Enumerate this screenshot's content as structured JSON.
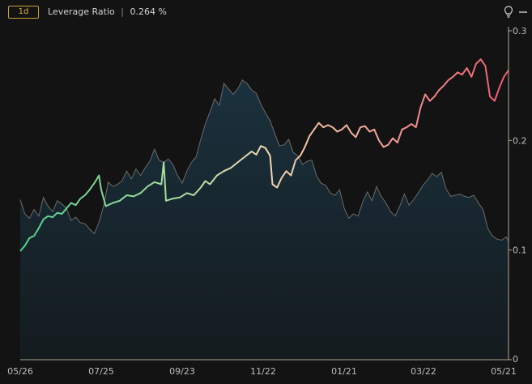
{
  "header": {
    "timeframe": "1d",
    "indicator_name": "Leverage Ratio",
    "separator": "|",
    "current_value": "0.264 %",
    "icons": [
      "lightbulb-icon",
      "minimize-icon"
    ]
  },
  "colors": {
    "background": "#131313",
    "area_fill": "#1a2e3a",
    "price_line": "#6b6b6b",
    "axis": "#b0a894",
    "gradient_low": "#4fd08a",
    "gradient_mid": "#e8dcb0",
    "gradient_high": "#f06070"
  },
  "chart_data": {
    "type": "line",
    "x_ticks": [
      "05/26",
      "07/25",
      "09/23",
      "11/22",
      "01/21",
      "03/22",
      "05/21"
    ],
    "y_ticks": [
      "0",
      "0.1",
      "0.2",
      "0.3"
    ],
    "ylim": [
      0,
      0.3
    ],
    "grid": false,
    "series": [
      {
        "role": "leverage-ratio",
        "style": "gradient-line",
        "points": [
          [
            0,
            0.099
          ],
          [
            2,
            0.104
          ],
          [
            4,
            0.111
          ],
          [
            6,
            0.113
          ],
          [
            8,
            0.12
          ],
          [
            10,
            0.128
          ],
          [
            12,
            0.131
          ],
          [
            14,
            0.13
          ],
          [
            16,
            0.134
          ],
          [
            18,
            0.133
          ],
          [
            20,
            0.138
          ],
          [
            22,
            0.143
          ],
          [
            24,
            0.141
          ],
          [
            26,
            0.147
          ],
          [
            28,
            0.15
          ],
          [
            30,
            0.155
          ],
          [
            32,
            0.161
          ],
          [
            34,
            0.168
          ],
          [
            35,
            0.155
          ],
          [
            37,
            0.14
          ],
          [
            40,
            0.143
          ],
          [
            43,
            0.145
          ],
          [
            46,
            0.15
          ],
          [
            49,
            0.149
          ],
          [
            52,
            0.152
          ],
          [
            55,
            0.158
          ],
          [
            58,
            0.162
          ],
          [
            61,
            0.16
          ],
          [
            62,
            0.18
          ],
          [
            63,
            0.145
          ],
          [
            66,
            0.147
          ],
          [
            69,
            0.148
          ],
          [
            72,
            0.152
          ],
          [
            75,
            0.15
          ],
          [
            78,
            0.157
          ],
          [
            80,
            0.163
          ],
          [
            82,
            0.16
          ],
          [
            85,
            0.168
          ],
          [
            88,
            0.172
          ],
          [
            91,
            0.175
          ],
          [
            94,
            0.18
          ],
          [
            97,
            0.185
          ],
          [
            100,
            0.19
          ],
          [
            102,
            0.187
          ],
          [
            104,
            0.195
          ],
          [
            106,
            0.193
          ],
          [
            108,
            0.186
          ],
          [
            109,
            0.16
          ],
          [
            111,
            0.157
          ],
          [
            113,
            0.166
          ],
          [
            115,
            0.172
          ],
          [
            117,
            0.168
          ],
          [
            119,
            0.182
          ],
          [
            121,
            0.186
          ],
          [
            123,
            0.194
          ],
          [
            125,
            0.204
          ],
          [
            127,
            0.21
          ],
          [
            129,
            0.216
          ],
          [
            131,
            0.212
          ],
          [
            133,
            0.214
          ],
          [
            135,
            0.212
          ],
          [
            137,
            0.208
          ],
          [
            139,
            0.21
          ],
          [
            141,
            0.214
          ],
          [
            143,
            0.207
          ],
          [
            145,
            0.203
          ],
          [
            147,
            0.212
          ],
          [
            149,
            0.213
          ],
          [
            151,
            0.208
          ],
          [
            153,
            0.21
          ],
          [
            155,
            0.2
          ],
          [
            157,
            0.194
          ],
          [
            159,
            0.196
          ],
          [
            161,
            0.202
          ],
          [
            163,
            0.198
          ],
          [
            165,
            0.21
          ],
          [
            167,
            0.212
          ],
          [
            169,
            0.215
          ],
          [
            171,
            0.212
          ],
          [
            173,
            0.23
          ],
          [
            175,
            0.242
          ],
          [
            177,
            0.236
          ],
          [
            179,
            0.24
          ],
          [
            181,
            0.246
          ],
          [
            183,
            0.25
          ],
          [
            185,
            0.255
          ],
          [
            187,
            0.258
          ],
          [
            189,
            0.262
          ],
          [
            191,
            0.26
          ],
          [
            193,
            0.266
          ],
          [
            195,
            0.258
          ],
          [
            197,
            0.27
          ],
          [
            199,
            0.274
          ],
          [
            201,
            0.268
          ],
          [
            203,
            0.24
          ],
          [
            205,
            0.236
          ],
          [
            207,
            0.248
          ],
          [
            209,
            0.258
          ],
          [
            211,
            0.264
          ]
        ]
      },
      {
        "role": "price",
        "style": "area",
        "points": [
          [
            0,
            0.146
          ],
          [
            2,
            0.133
          ],
          [
            4,
            0.129
          ],
          [
            6,
            0.137
          ],
          [
            8,
            0.131
          ],
          [
            10,
            0.148
          ],
          [
            12,
            0.14
          ],
          [
            14,
            0.135
          ],
          [
            16,
            0.145
          ],
          [
            18,
            0.142
          ],
          [
            20,
            0.138
          ],
          [
            22,
            0.127
          ],
          [
            24,
            0.13
          ],
          [
            26,
            0.125
          ],
          [
            28,
            0.124
          ],
          [
            30,
            0.119
          ],
          [
            32,
            0.115
          ],
          [
            34,
            0.125
          ],
          [
            36,
            0.14
          ],
          [
            38,
            0.162
          ],
          [
            40,
            0.158
          ],
          [
            42,
            0.16
          ],
          [
            44,
            0.163
          ],
          [
            46,
            0.172
          ],
          [
            48,
            0.165
          ],
          [
            50,
            0.174
          ],
          [
            52,
            0.168
          ],
          [
            54,
            0.175
          ],
          [
            56,
            0.181
          ],
          [
            58,
            0.192
          ],
          [
            60,
            0.182
          ],
          [
            62,
            0.18
          ],
          [
            64,
            0.183
          ],
          [
            66,
            0.178
          ],
          [
            68,
            0.168
          ],
          [
            70,
            0.161
          ],
          [
            72,
            0.172
          ],
          [
            74,
            0.18
          ],
          [
            76,
            0.185
          ],
          [
            78,
            0.201
          ],
          [
            80,
            0.215
          ],
          [
            82,
            0.226
          ],
          [
            84,
            0.238
          ],
          [
            86,
            0.232
          ],
          [
            88,
            0.252
          ],
          [
            90,
            0.247
          ],
          [
            92,
            0.242
          ],
          [
            94,
            0.247
          ],
          [
            96,
            0.255
          ],
          [
            98,
            0.252
          ],
          [
            100,
            0.246
          ],
          [
            102,
            0.243
          ],
          [
            104,
            0.233
          ],
          [
            106,
            0.225
          ],
          [
            108,
            0.218
          ],
          [
            110,
            0.206
          ],
          [
            112,
            0.195
          ],
          [
            114,
            0.196
          ],
          [
            116,
            0.201
          ],
          [
            118,
            0.189
          ],
          [
            120,
            0.186
          ],
          [
            122,
            0.178
          ],
          [
            124,
            0.181
          ],
          [
            126,
            0.182
          ],
          [
            128,
            0.168
          ],
          [
            130,
            0.161
          ],
          [
            132,
            0.159
          ],
          [
            134,
            0.152
          ],
          [
            136,
            0.15
          ],
          [
            138,
            0.155
          ],
          [
            140,
            0.138
          ],
          [
            142,
            0.129
          ],
          [
            144,
            0.133
          ],
          [
            146,
            0.131
          ],
          [
            148,
            0.144
          ],
          [
            150,
            0.153
          ],
          [
            152,
            0.145
          ],
          [
            154,
            0.158
          ],
          [
            156,
            0.149
          ],
          [
            158,
            0.143
          ],
          [
            160,
            0.135
          ],
          [
            162,
            0.131
          ],
          [
            164,
            0.14
          ],
          [
            166,
            0.151
          ],
          [
            168,
            0.141
          ],
          [
            170,
            0.146
          ],
          [
            172,
            0.152
          ],
          [
            174,
            0.159
          ],
          [
            176,
            0.164
          ],
          [
            178,
            0.17
          ],
          [
            180,
            0.167
          ],
          [
            182,
            0.171
          ],
          [
            184,
            0.156
          ],
          [
            186,
            0.149
          ],
          [
            188,
            0.15
          ],
          [
            190,
            0.151
          ],
          [
            192,
            0.149
          ],
          [
            194,
            0.148
          ],
          [
            196,
            0.15
          ],
          [
            198,
            0.143
          ],
          [
            200,
            0.137
          ],
          [
            202,
            0.12
          ],
          [
            204,
            0.113
          ],
          [
            206,
            0.11
          ],
          [
            208,
            0.109
          ],
          [
            210,
            0.112
          ],
          [
            211,
            0.108
          ]
        ]
      }
    ]
  }
}
